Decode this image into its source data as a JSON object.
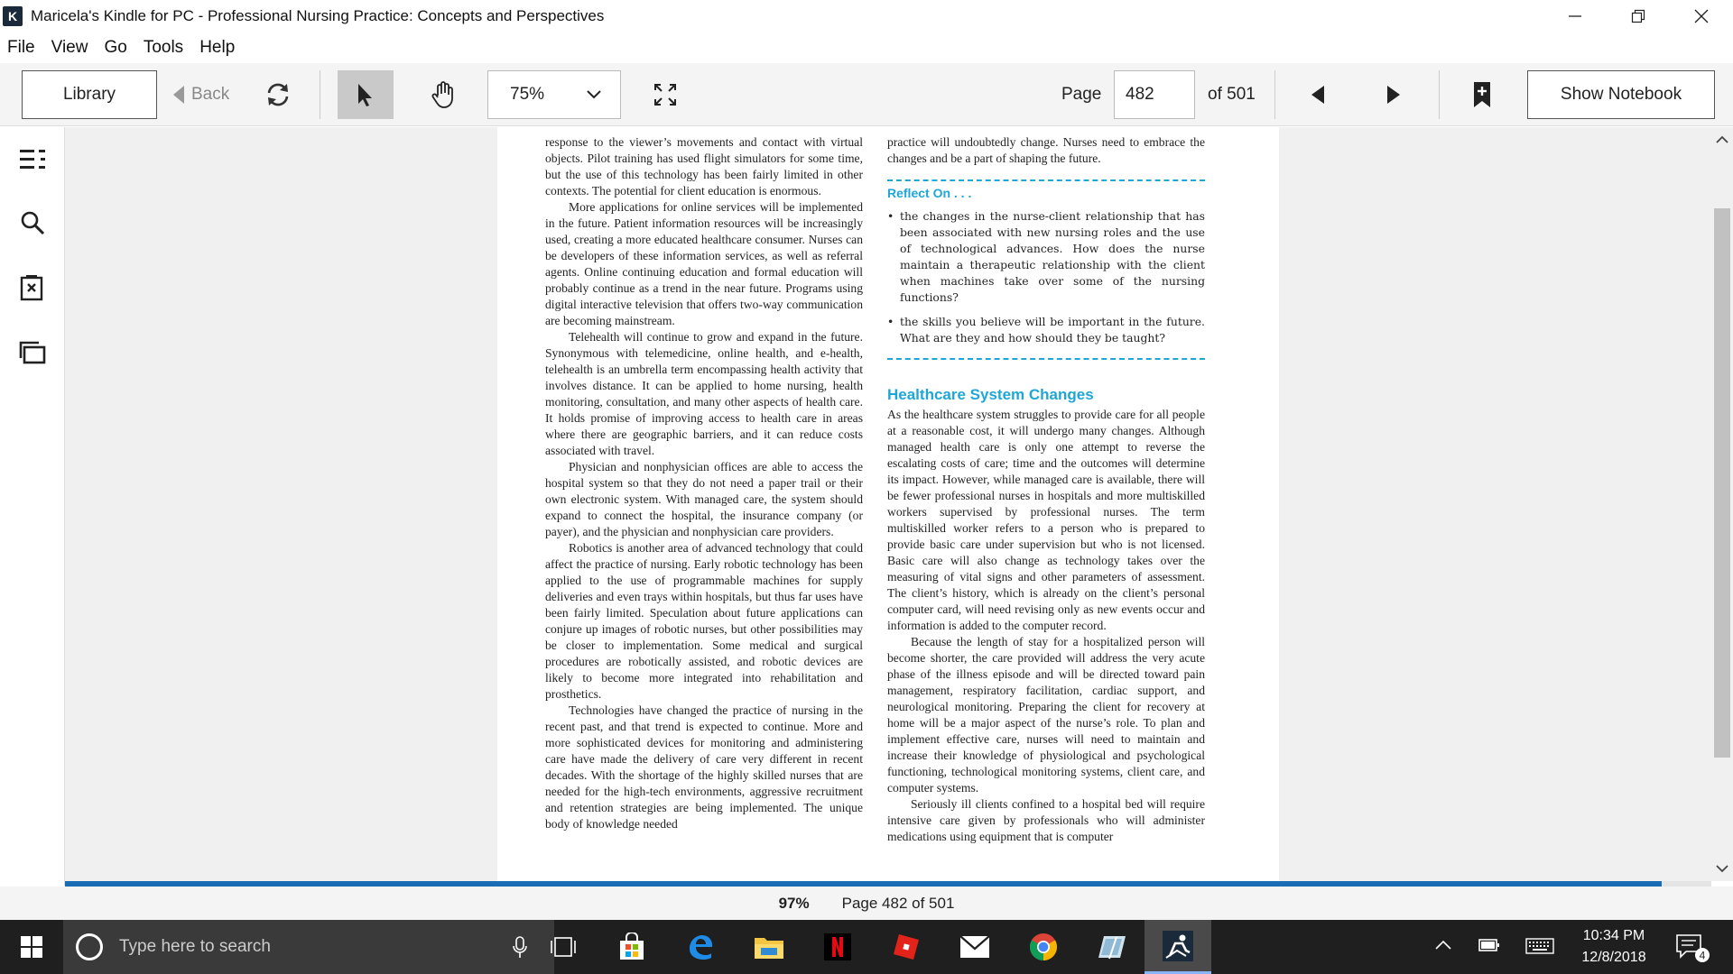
{
  "window": {
    "title": "Maricela's Kindle for PC - Professional Nursing Practice: Concepts and Perspectives",
    "app_icon_glyph": "K"
  },
  "menu": [
    "File",
    "View",
    "Go",
    "Tools",
    "Help"
  ],
  "toolbar": {
    "library_label": "Library",
    "back_label": "Back",
    "zoom_value": "75%",
    "page_label": "Page",
    "page_value": "482",
    "of_label": "of 501",
    "notebook_label": "Show Notebook"
  },
  "book": {
    "left_column": [
      {
        "indent": false,
        "text": "response to the viewer’s movements and contact with virtual objects. Pilot training has used flight simulators for some time, but the use of this technology has been fairly limited in other contexts. The potential for client education is enormous."
      },
      {
        "indent": true,
        "text": "More applications for online services will be implemented in the future. Patient information resources will be increasingly used, creating a more educated healthcare consumer. Nurses can be developers of these information services, as well as referral agents. Online continuing education and formal education will probably continue as a trend in the near future. Programs using digital interactive television that offers two-way communication are becoming mainstream."
      },
      {
        "indent": true,
        "text": "Telehealth will continue to grow and expand in the future. Synonymous with telemedicine, online health, and e-health, telehealth is an umbrella term encompassing health activity that involves distance. It can be applied to home nursing, health monitoring, consultation, and many other aspects of health care. It holds promise of improving access to health care in areas where there are geographic barriers, and it can reduce costs associated with travel."
      },
      {
        "indent": true,
        "text": "Physician and nonphysician offices are able to access the hospital system so that they do not need a paper trail or their own electronic system. With managed care, the system should expand to connect the hospital, the insurance company (or payer), and the physician and nonphysician care providers."
      },
      {
        "indent": true,
        "text": "Robotics is another area of advanced technology that could affect the practice of nursing. Early robotic technology has been applied to the use of programmable machines for supply deliveries and even trays within hospitals, but thus far uses have been fairly limited. Speculation about future applications can conjure up images of robotic nurses, but other possibilities may be closer to implementation. Some medical and surgical procedures are robotically assisted, and robotic devices are likely to become more integrated into rehabilitation and prosthetics."
      },
      {
        "indent": true,
        "text": "Technologies have changed the practice of nursing in the recent past, and that trend is expected to continue. More and more sophisticated devices for monitoring and administering care have made the delivery of care very different in recent decades. With the shortage of the highly skilled nurses that are needed for the high-tech environments, aggressive recruitment and retention strategies are being implemented. The unique body of knowledge needed"
      }
    ],
    "right_intro": "practice will undoubtedly change. Nurses need to embrace the changes and be a part of shaping the future.",
    "reflect_title": "Reflect On . . .",
    "reflect_items": [
      "the changes in the nurse-client relationship that has been associated with new nursing roles and the use of technological advances. How does the nurse maintain a therapeutic relationship with the client when machines take over some of the nursing functions?",
      "the skills you believe will be important in the future. What are they and how should they be taught?"
    ],
    "section_heading": "Healthcare System Changes",
    "right_column": [
      {
        "indent": false,
        "text": "As the healthcare system struggles to provide care for all people at a reasonable cost, it will undergo many changes. Although managed health care is only one attempt to reverse the escalating costs of care; time and the outcomes will determine its impact. However, while managed care is available, there will be fewer professional nurses in hospitals and more multiskilled workers supervised by professional nurses. The term multiskilled worker refers to a person who is prepared to provide basic care under supervision but who is not licensed. Basic care will also change as technology takes over the measuring of vital signs and other parameters of assessment. The client’s history, which is already on the client’s personal computer card, will need revising only as new events occur and information is added to the computer record."
      },
      {
        "indent": true,
        "text": "Because the length of stay for a hospitalized person will become shorter, the care provided will address the very acute phase of the illness episode and will be directed toward pain management, respiratory facilitation, cardiac support, and neurological monitoring. Preparing the client for recovery at home will be a major aspect of the nurse’s role. To plan and implement effective care, nurses will need to maintain and increase their knowledge of physiological and psychological functioning, technological monitoring systems, client care, and computer systems."
      },
      {
        "indent": true,
        "text": "Seriously ill clients confined to a hospital bed will require intensive care given by professionals who will administer medications using equipment that is computer"
      }
    ]
  },
  "progress": {
    "percent_label": "97%",
    "percent_value": 0.97,
    "page_status": "Page 482 of 501"
  },
  "scroll": {
    "thumb_start": 0.08,
    "thumb_end": 0.86
  },
  "taskbar": {
    "search_placeholder": "Type here to search",
    "apps": [
      "task-view",
      "microsoft-store",
      "edge",
      "file-explorer",
      "netflix",
      "roblox",
      "mail",
      "chrome",
      "notes",
      "kindle"
    ],
    "time": "10:34 PM",
    "date": "12/8/2018",
    "notification_count": "4"
  },
  "colors": {
    "accent": "#1ea7d6",
    "progress": "#1a6db5",
    "taskbar": "#1f1f1f"
  }
}
